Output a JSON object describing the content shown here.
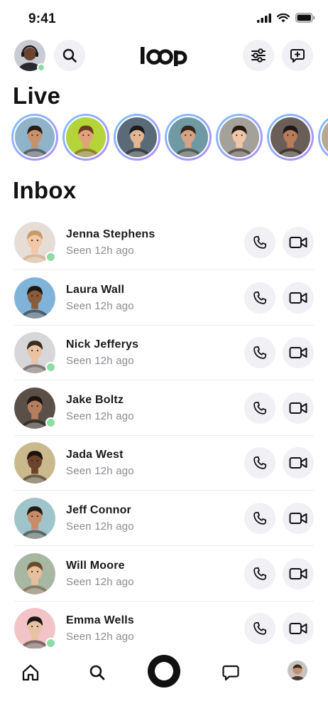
{
  "status_bar": {
    "time": "9:41"
  },
  "header": {
    "logo_text": "loop",
    "icons": [
      "profile-avatar",
      "search-icon",
      "filter-sliders-icon",
      "new-message-icon"
    ]
  },
  "live": {
    "title": "Live",
    "avatars": [
      {
        "id": "live-1",
        "bg": "#8fb3c9",
        "skin": "#c8916c",
        "hair": "#2b1d14"
      },
      {
        "id": "live-2",
        "bg": "#b5d43a",
        "skin": "#e0a27d",
        "hair": "#6b3b1f"
      },
      {
        "id": "live-3",
        "bg": "#5a6a77",
        "skin": "#e4b592",
        "hair": "#1b1b1b"
      },
      {
        "id": "live-4",
        "bg": "#6f9aa3",
        "skin": "#d4a285",
        "hair": "#3a2618"
      },
      {
        "id": "live-5",
        "bg": "#a3a19a",
        "skin": "#f0c6a8",
        "hair": "#2a1b12"
      },
      {
        "id": "live-6",
        "bg": "#6a5f58",
        "skin": "#b77c5a",
        "hair": "#1f1612"
      },
      {
        "id": "live-7",
        "bg": "#b7a894",
        "skin": "#d8a98a",
        "hair": "#2c2019"
      }
    ]
  },
  "inbox": {
    "title": "Inbox",
    "contacts": [
      {
        "name": "Jenna Stephens",
        "status": "Seen 12h ago",
        "online": true,
        "bg": "#e6ddd6",
        "skin": "#f1c7a8",
        "hair": "#c79a6a"
      },
      {
        "name": "Laura Wall",
        "status": "Seen 12h ago",
        "online": false,
        "bg": "#7fb4d8",
        "skin": "#8a5a3d",
        "hair": "#1d1611"
      },
      {
        "name": "Nick Jefferys",
        "status": "Seen 12h ago",
        "online": true,
        "bg": "#d7d6d9",
        "skin": "#e9c3a4",
        "hair": "#3a2a1f"
      },
      {
        "name": "Jake Boltz",
        "status": "Seen 12h ago",
        "online": true,
        "bg": "#5b5048",
        "skin": "#b57e5e",
        "hair": "#1b1410"
      },
      {
        "name": "Jada West",
        "status": "Seen 12h ago",
        "online": false,
        "bg": "#c9b98c",
        "skin": "#6e432b",
        "hair": "#1a1210"
      },
      {
        "name": "Jeff Connor",
        "status": "Seen 12h ago",
        "online": false,
        "bg": "#9fc4c9",
        "skin": "#c78c68",
        "hair": "#241a14"
      },
      {
        "name": "Will Moore",
        "status": "Seen 12h ago",
        "online": false,
        "bg": "#a8b7a2",
        "skin": "#e8bf9c",
        "hair": "#6b4a2c"
      },
      {
        "name": "Emma Wells",
        "status": "Seen 12h ago",
        "online": true,
        "bg": "#f2c4c7",
        "skin": "#e9c2a3",
        "hair": "#1f1712"
      }
    ]
  },
  "tabbar": {
    "items": [
      "home-icon",
      "search-icon",
      "record-button",
      "chat-icon",
      "profile-avatar"
    ]
  },
  "colors": {
    "button_bg": "#f0f0f5",
    "online": "#8edba6",
    "muted_text": "#8a8a92",
    "live_ring_start": "#7dc4ff",
    "live_ring_end": "#b38cff"
  }
}
